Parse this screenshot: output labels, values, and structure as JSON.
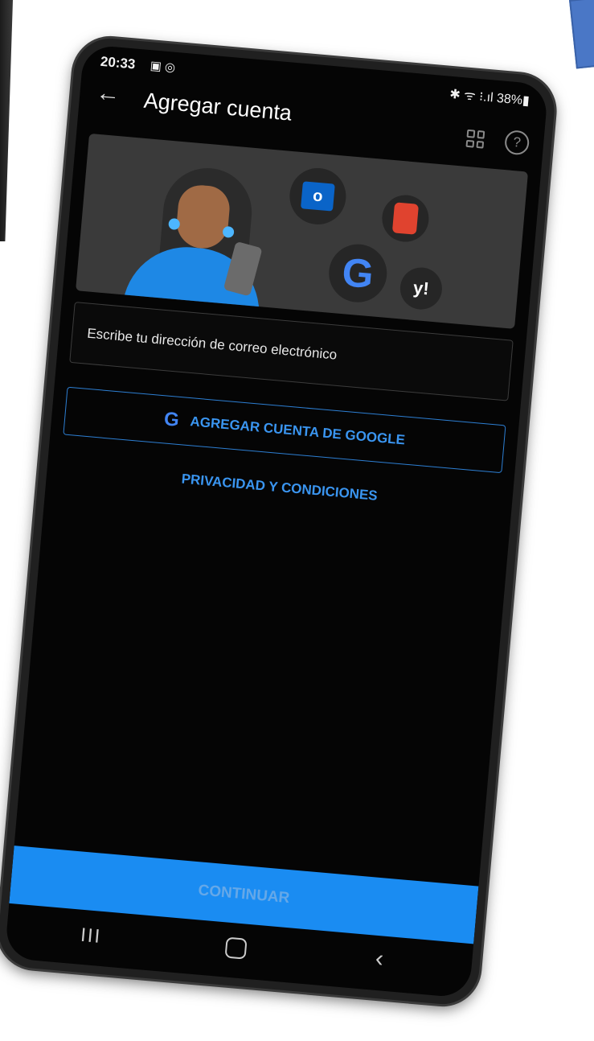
{
  "status_bar": {
    "time": "20:33",
    "left_icons": "▣ ◎",
    "right_indicators": "✱ ᯤ ⁝.ıl 38%▮"
  },
  "app_bar": {
    "back_glyph": "←",
    "title": "Agregar cuenta",
    "help_glyph": "?"
  },
  "hero": {
    "outlook_letter": "o",
    "google_letter": "G",
    "yahoo_text": "y!"
  },
  "email_field": {
    "placeholder": "Escribe tu dirección de correo electrónico"
  },
  "google_button": {
    "icon_letter": "G",
    "label": "AGREGAR CUENTA DE GOOGLE"
  },
  "privacy_link": "PRIVACIDAD Y CONDICIONES",
  "continue_button": "CONTINUAR",
  "nav_bar": {
    "recent_glyph": "III",
    "back_glyph": "‹"
  },
  "colors": {
    "accent": "#1a8cf2",
    "link": "#3a95f0",
    "screen_bg": "#050505"
  }
}
